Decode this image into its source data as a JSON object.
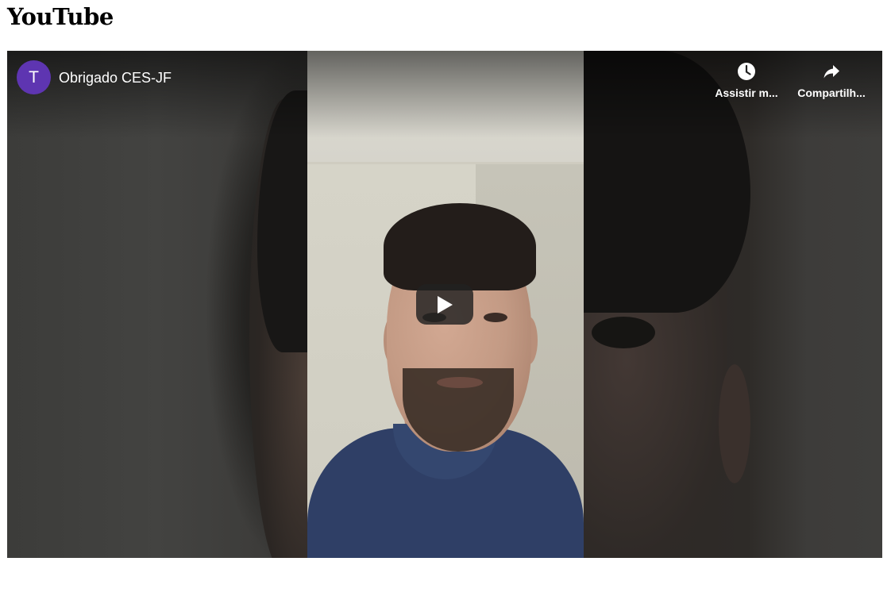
{
  "page": {
    "heading": "YouTube"
  },
  "player": {
    "channel_avatar_letter": "T",
    "video_title": "Obrigado CES-JF",
    "actions": {
      "watch_later_label": "Assistir m...",
      "share_label": "Compartilh..."
    },
    "icons": {
      "watch_later": "clock-icon",
      "share": "share-arrow-icon",
      "play": "play-icon"
    },
    "colors": {
      "avatar_bg": "#5e35b1",
      "play_button_bg": "#212121"
    }
  }
}
